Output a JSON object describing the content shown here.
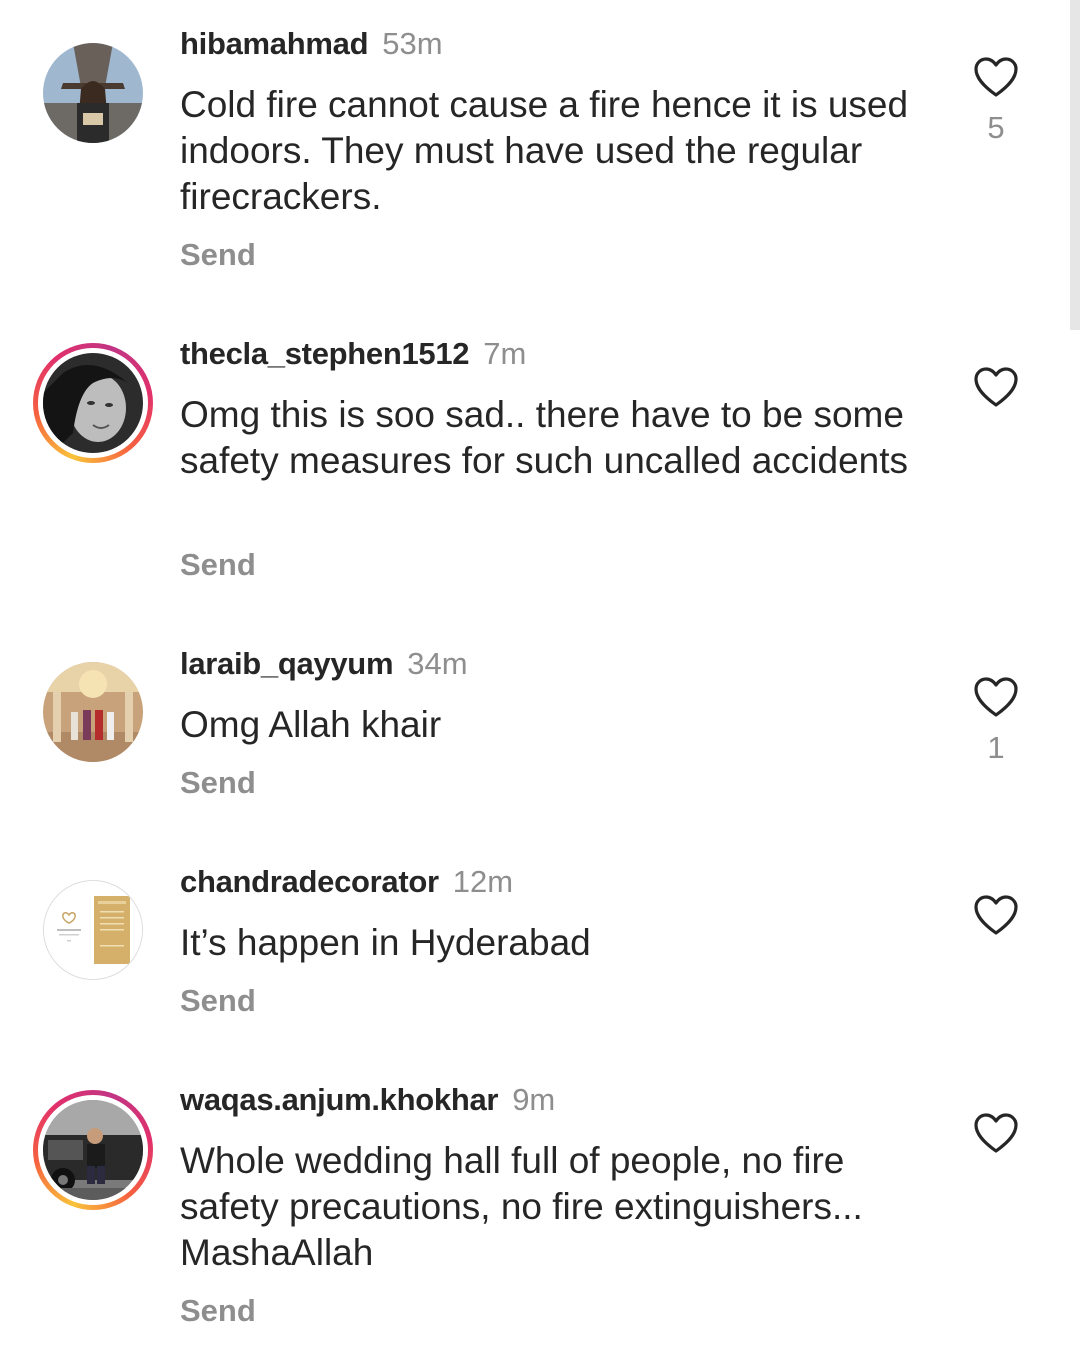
{
  "comments": [
    {
      "username": "hibamahmad",
      "time": "53m",
      "text": "Cold fire cannot cause a fire hence it is used indoors. They must have used the regular firecrackers.",
      "send": "Send",
      "likes": "5",
      "avatar_icon": "eiffel-tower-photo"
    },
    {
      "username": "thecla_stephen1512",
      "time": "7m",
      "text": "Omg this is soo sad.. there have to be some safety measures for such uncalled accidents",
      "send": "Send",
      "likes": "",
      "avatar_icon": "portrait-photo"
    },
    {
      "username": "laraib_qayyum",
      "time": "34m",
      "text": "Omg Allah khair",
      "send": "Send",
      "likes": "1",
      "avatar_icon": "wedding-hall-photo"
    },
    {
      "username": "chandradecorator",
      "time": "12m",
      "text": "It’s happen in Hyderabad",
      "send": "Send",
      "likes": "",
      "avatar_icon": "invitation-card-logo"
    },
    {
      "username": "waqas.anjum.khokhar",
      "time": "9m",
      "text": "Whole wedding hall full of people, no fire safety precautions, no fire extinguishers... MashaAllah",
      "send": "Send",
      "likes": "",
      "avatar_icon": "car-portrait-photo"
    }
  ],
  "colors": {
    "primary_text": "#262626",
    "secondary_text": "#8e8e8e",
    "story_ring": [
      "#f9c33a",
      "#f56040",
      "#e1306c",
      "#c13584"
    ]
  }
}
